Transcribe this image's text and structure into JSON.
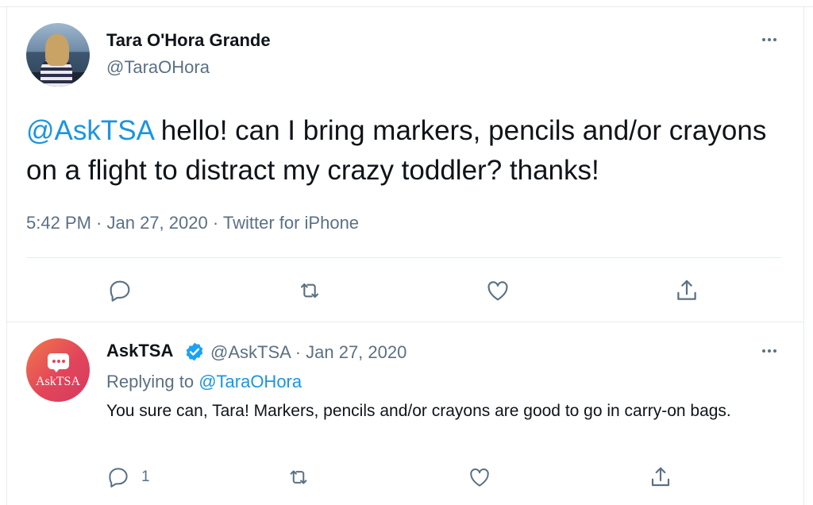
{
  "main_tweet": {
    "author_name": "Tara O'Hora Grande",
    "author_handle": "@TaraOHora",
    "text_mention": "@AskTSA",
    "text_body": " hello! can I bring markers, pencils and/or crayons on a flight to distract my crazy toddler? thanks!",
    "meta": "5:42 PM · Jan 27, 2020 · Twitter for iPhone",
    "actions": [
      "reply-icon",
      "retweet-icon",
      "like-icon",
      "share-icon"
    ]
  },
  "reply_tweet": {
    "author_name": "AskTSA",
    "author_handle_date": "@AskTSA · Jan 27, 2020",
    "avatar_logo": "AskTSA",
    "replying_prefix": "Replying to ",
    "replying_to": "@TaraOHora",
    "text": "You sure can, Tara! Markers, pencils and/or crayons are good to go in carry-on bags.",
    "reply_count": "1",
    "actions": [
      "reply-icon",
      "retweet-icon",
      "like-icon",
      "share-icon"
    ]
  },
  "colors": {
    "link": "#1b95e0",
    "secondary_text": "#5b7083",
    "primary_text": "#0f1419",
    "verified": "#1da1f2",
    "border": "#e6ecf0"
  }
}
